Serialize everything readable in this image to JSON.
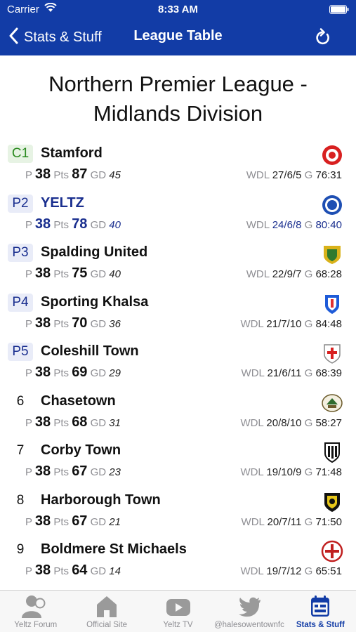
{
  "status_bar": {
    "carrier": "Carrier",
    "time": "8:33 AM"
  },
  "nav": {
    "back_label": "Stats & Stuff",
    "title": "League Table"
  },
  "league_title": "Northern Premier League - Midlands Division",
  "labels": {
    "p": "P",
    "pts": "Pts",
    "gd": "GD",
    "wdl": "WDL",
    "g": "G"
  },
  "teams": [
    {
      "pos": "C1",
      "name": "Stamford",
      "played": "38",
      "points": "87",
      "gd": "45",
      "wdl": "27/6/5",
      "goals": "76:31"
    },
    {
      "pos": "P2",
      "name": "YELTZ",
      "played": "38",
      "points": "78",
      "gd": "40",
      "wdl": "24/6/8",
      "goals": "80:40"
    },
    {
      "pos": "P3",
      "name": "Spalding United",
      "played": "38",
      "points": "75",
      "gd": "40",
      "wdl": "22/9/7",
      "goals": "68:28"
    },
    {
      "pos": "P4",
      "name": "Sporting Khalsa",
      "played": "38",
      "points": "70",
      "gd": "36",
      "wdl": "21/7/10",
      "goals": "84:48"
    },
    {
      "pos": "P5",
      "name": "Coleshill Town",
      "played": "38",
      "points": "69",
      "gd": "29",
      "wdl": "21/6/11",
      "goals": "68:39"
    },
    {
      "pos": "6",
      "name": "Chasetown",
      "played": "38",
      "points": "68",
      "gd": "31",
      "wdl": "20/8/10",
      "goals": "58:27"
    },
    {
      "pos": "7",
      "name": "Corby Town",
      "played": "38",
      "points": "67",
      "gd": "23",
      "wdl": "19/10/9",
      "goals": "71:48"
    },
    {
      "pos": "8",
      "name": "Harborough Town",
      "played": "38",
      "points": "67",
      "gd": "21",
      "wdl": "20/7/11",
      "goals": "71:50"
    },
    {
      "pos": "9",
      "name": "Boldmere St Michaels",
      "played": "38",
      "points": "64",
      "gd": "14",
      "wdl": "19/7/12",
      "goals": "65:51"
    }
  ],
  "tabs": [
    {
      "label": "Yeltz Forum",
      "icon": "forum-icon"
    },
    {
      "label": "Official Site",
      "icon": "home-icon"
    },
    {
      "label": "Yeltz TV",
      "icon": "play-icon"
    },
    {
      "label": "@halesowentownfc",
      "icon": "twitter-icon"
    },
    {
      "label": "Stats & Stuff",
      "icon": "calendar-icon"
    }
  ],
  "colors": {
    "nav_bg": "#123ca6",
    "champion": "#2a8a1f",
    "promotion": "#1a2f8f",
    "highlight_team": "#1a2f8f"
  }
}
